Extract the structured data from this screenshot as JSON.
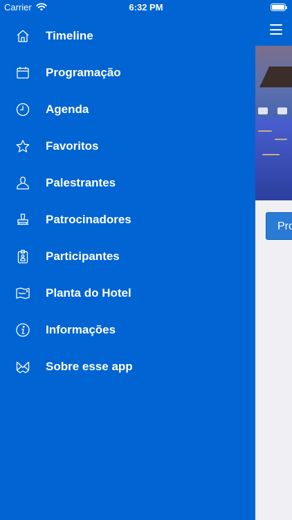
{
  "status_bar": {
    "carrier": "Carrier",
    "time": "6:32 PM"
  },
  "menu": {
    "items": [
      {
        "label": "Timeline",
        "icon": "home-icon"
      },
      {
        "label": "Programação",
        "icon": "calendar-icon"
      },
      {
        "label": "Agenda",
        "icon": "clock-icon"
      },
      {
        "label": "Favoritos",
        "icon": "star-icon"
      },
      {
        "label": "Palestrantes",
        "icon": "person-icon"
      },
      {
        "label": "Patrocinadores",
        "icon": "stamp-icon"
      },
      {
        "label": "Participantes",
        "icon": "badge-icon"
      },
      {
        "label": "Planta do Hotel",
        "icon": "map-icon"
      },
      {
        "label": "Informações",
        "icon": "info-icon"
      },
      {
        "label": "Sobre esse app",
        "icon": "envelope-icon"
      }
    ]
  },
  "content": {
    "card_button_label": "Pro"
  },
  "colors": {
    "drawer_background": "#0064d2",
    "content_background": "#efeff4"
  }
}
